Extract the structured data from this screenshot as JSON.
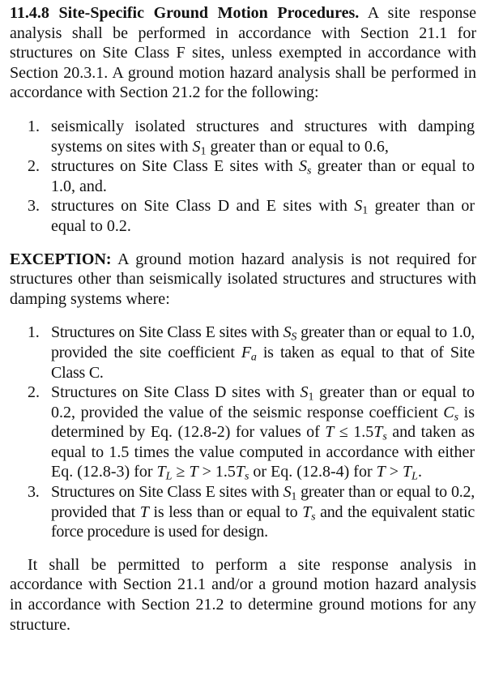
{
  "heading": "11.4.8 Site-Specific Ground Motion Procedures.",
  "intro_text": "A site response analysis shall be performed in accordance with Section 21.1 for structures on Site Class F sites, unless exempted in accordance with Section 20.3.1. A ground motion hazard analysis shall be performed in accordance with Section 21.2 for the following:",
  "list1": [
    {
      "num": "1.",
      "a": "seismically isolated structures and structures with damping systems on sites with ",
      "s1": "S",
      "s1sub": "1",
      "b": " greater than or equal to 0.6,"
    },
    {
      "num": "2.",
      "a": "structures on Site Class E sites with ",
      "s1": "S",
      "s1sub": "s",
      "b": " greater than or equal to 1.0, and."
    },
    {
      "num": "3.",
      "a": "structures on Site Class D and E sites with ",
      "s1": "S",
      "s1sub": "1",
      "b": " greater than or equal to 0.2."
    }
  ],
  "exception": {
    "label": "EXCEPTION:",
    "text": " A ground motion hazard analysis is not required for structures other than seismically isolated structures and structures with damping systems where:"
  },
  "list2": {
    "item1": {
      "num": "1.",
      "a": "Structures on Site Class E sites with ",
      "v1": "S",
      "v1sub": "S",
      "b": " greater than or equal to 1.0, provided the site coefficient ",
      "v2": "F",
      "v2sub": "a",
      "c": " is taken as equal to that of Site Class C."
    },
    "item2": {
      "num": "2.",
      "a": "Structures on Site Class D sites with ",
      "v1": "S",
      "v1sub": "1",
      "b": " greater than or equal to 0.2, provided the value of the seismic response coefficient ",
      "v2": "C",
      "v2sub": "s",
      "c": " is determined by Eq. (12.8-2) for values of ",
      "t1": "T",
      "d": " ≤ 1.5",
      "t2": "T",
      "t2sub": "s",
      "e": " and taken as equal to 1.5 times the value computed in accordance with either Eq. (12.8-3) for ",
      "t3": "T",
      "t3sub": "L",
      "f": " ≥ ",
      "t4": "T",
      "g": " > 1.5",
      "t5": "T",
      "t5sub": "s",
      "h": " or Eq. (12.8-4) for ",
      "t6": "T",
      "i": " > ",
      "t7": "T",
      "t7sub": "L",
      "j": "."
    },
    "item3": {
      "num": "3.",
      "a": "Structures on Site Class E sites with ",
      "v1": "S",
      "v1sub": "1",
      "b": " greater than or equal to 0.2, provided that ",
      "t1": "T",
      "c": " is less than or equal to ",
      "t2": "T",
      "t2sub": "s",
      "d": " and the equivalent static force procedure is used for design."
    }
  },
  "final_text": "It shall be permitted to perform a site response analysis in accordance with Section 21.1 and/or a ground motion hazard analysis in accordance with Section 21.2 to determine ground motions for any structure."
}
